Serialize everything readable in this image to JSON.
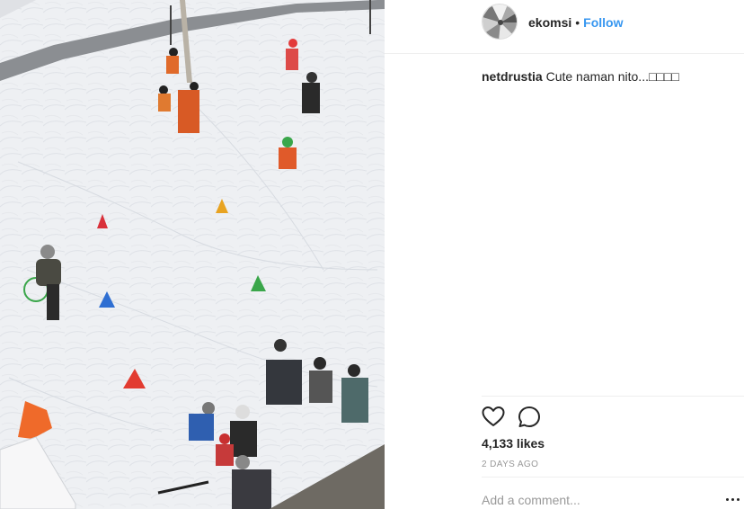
{
  "post": {
    "photo_alt": "photo-children-skiing-in-snow",
    "author": {
      "username": "ekomsi",
      "separator": "•",
      "follow_label": "Follow",
      "avatar_icon": "profile-avatar"
    },
    "caption": {
      "username": "netdrustia",
      "text": "Cute naman nito...□□□□"
    },
    "actions": {
      "like_icon": "heart-icon",
      "comment_icon": "comment-icon"
    },
    "likes_text": "4,133 likes",
    "timestamp": "2 DAYS AGO",
    "comment_placeholder": "Add a comment...",
    "more_icon": "more-options-icon"
  },
  "colors": {
    "link": "#3897f0",
    "text": "#262626",
    "muted": "#999999",
    "divider": "#efefef"
  }
}
